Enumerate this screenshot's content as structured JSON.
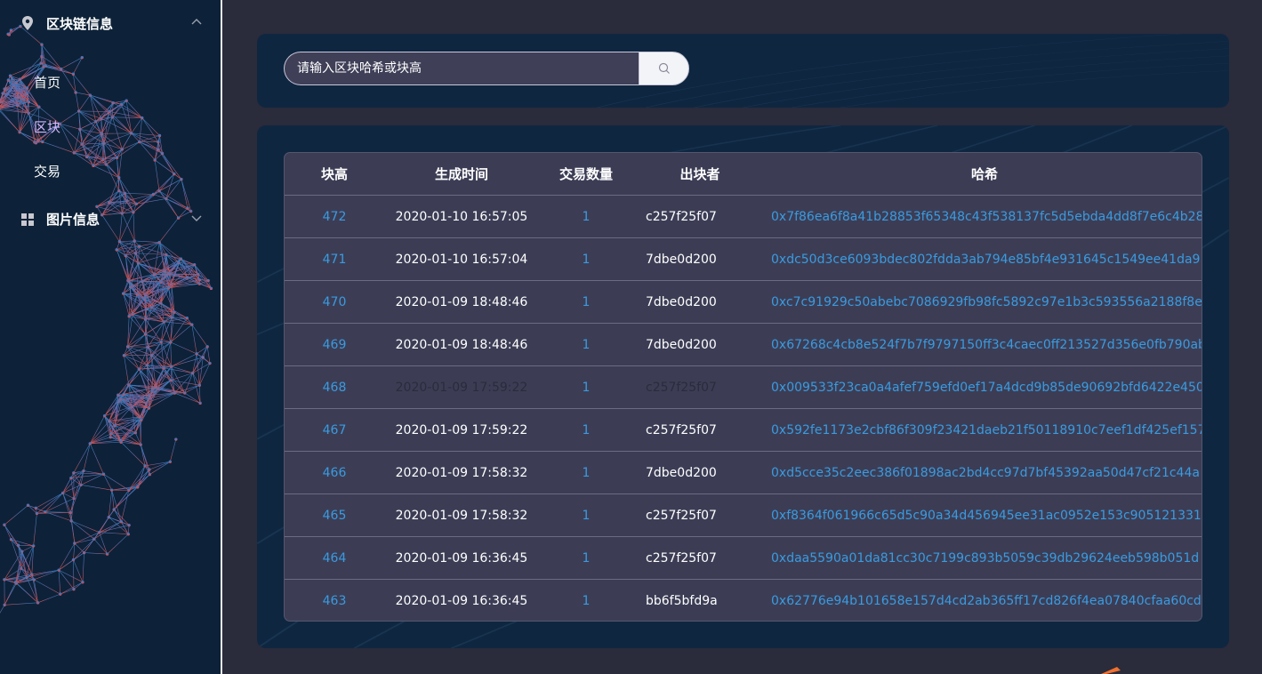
{
  "sidebar": {
    "group1": {
      "label": "区块链信息",
      "icon": "location-pin-icon"
    },
    "items": [
      {
        "label": "首页",
        "active": false
      },
      {
        "label": "区块",
        "active": true
      },
      {
        "label": "交易",
        "active": false
      }
    ],
    "group2": {
      "label": "图片信息",
      "icon": "grid-icon"
    }
  },
  "search": {
    "placeholder": "请输入区块哈希或块高",
    "icon": "search-icon"
  },
  "table": {
    "headers": [
      "块高",
      "生成时间",
      "交易数量",
      "出块者",
      "哈希"
    ],
    "rows": [
      {
        "height": "472",
        "time": "2020-01-10 16:57:05",
        "count": "1",
        "miner": "c257f25f07",
        "hash": "0x7f86ea6f8a41b28853f65348c43f538137fc5d5ebda4dd8f7e6c4b28"
      },
      {
        "height": "471",
        "time": "2020-01-10 16:57:04",
        "count": "1",
        "miner": "7dbe0d200",
        "hash": "0xdc50d3ce6093bdec802fdda3ab794e85bf4e931645c1549ee41da9"
      },
      {
        "height": "470",
        "time": "2020-01-09 18:48:46",
        "count": "1",
        "miner": "7dbe0d200",
        "hash": "0xc7c91929c50abebc7086929fb98fc5892c97e1b3c593556a2188f8e"
      },
      {
        "height": "469",
        "time": "2020-01-09 18:48:46",
        "count": "1",
        "miner": "7dbe0d200",
        "hash": "0x67268c4cb8e524f7b7f9797150ff3c4caec0ff213527d356e0fb790ab"
      },
      {
        "height": "468",
        "time": "2020-01-09 17:59:22",
        "count": "1",
        "miner": "c257f25f07",
        "hash": "0x009533f23ca0a4afef759efd0ef17a4dcd9b85de90692bfd6422e450f",
        "dim": true
      },
      {
        "height": "467",
        "time": "2020-01-09 17:59:22",
        "count": "1",
        "miner": "c257f25f07",
        "hash": "0x592fe1173e2cbf86f309f23421daeb21f50118910c7eef1df425ef157"
      },
      {
        "height": "466",
        "time": "2020-01-09 17:58:32",
        "count": "1",
        "miner": "7dbe0d200",
        "hash": "0xd5cce35c2eec386f01898ac2bd4cc97d7bf45392aa50d47cf21c44a"
      },
      {
        "height": "465",
        "time": "2020-01-09 17:58:32",
        "count": "1",
        "miner": "c257f25f07",
        "hash": "0xf8364f061966c65d5c90a34d456945ee31ac0952e153c905121331"
      },
      {
        "height": "464",
        "time": "2020-01-09 16:36:45",
        "count": "1",
        "miner": "c257f25f07",
        "hash": "0xdaa5590a01da81cc30c7199c893b5059c39db29624eeb598b051d"
      },
      {
        "height": "463",
        "time": "2020-01-09 16:36:45",
        "count": "1",
        "miner": "bb6f5bfd9a",
        "hash": "0x62776e94b101658e157d4cd2ab365ff17cd826f4ea07840cfaa60cd"
      }
    ]
  },
  "colors": {
    "link": "#3a9be0",
    "active_menu": "#d9b8ff",
    "sidebar_bg": "#0d2238",
    "page_bg": "#2a2b3b"
  }
}
